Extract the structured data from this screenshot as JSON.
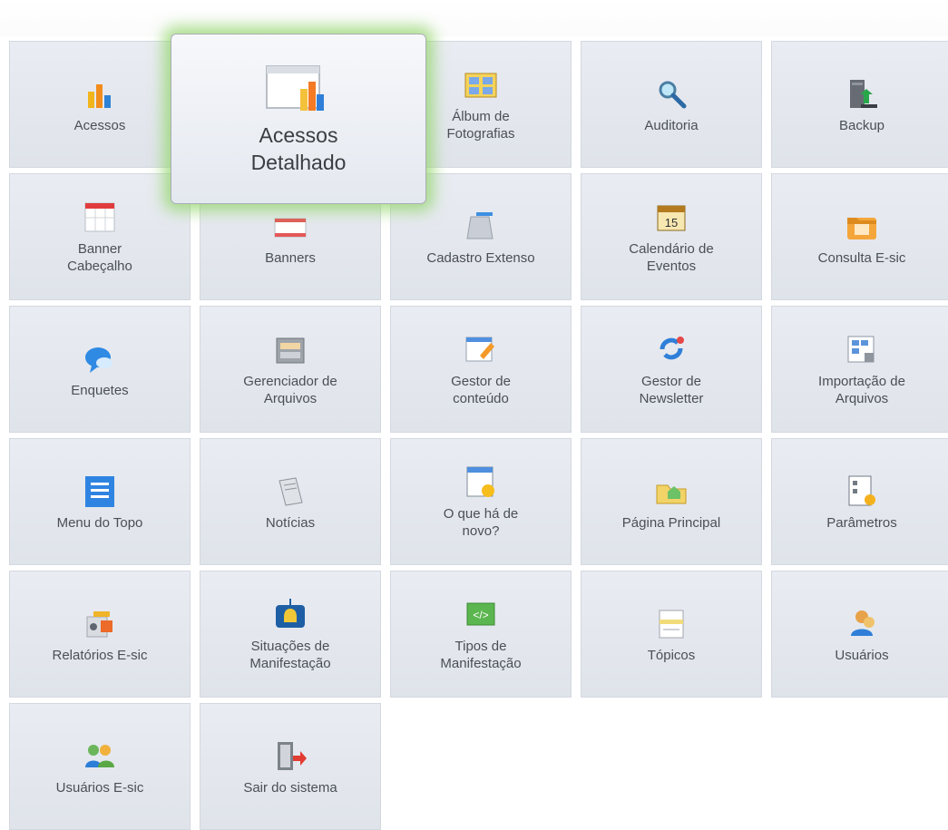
{
  "menu": {
    "hover_tile": {
      "label": "Acessos\nDetalhado",
      "icon": "report-chart-icon"
    },
    "tiles": [
      {
        "label": "Acessos",
        "icon": "chart-bars-icon"
      },
      {
        "label": "Acessos Detalhado",
        "icon": "report-chart-icon"
      },
      {
        "label": "Álbum de\nFotografias",
        "icon": "photo-album-icon"
      },
      {
        "label": "Auditoria",
        "icon": "magnifier-icon"
      },
      {
        "label": "Backup",
        "icon": "server-backup-icon"
      },
      {
        "label": "Banner\nCabeçalho",
        "icon": "calendar-grid-icon"
      },
      {
        "label": "Banners",
        "icon": "banner-icon"
      },
      {
        "label": "Cadastro Extenso",
        "icon": "form-icon"
      },
      {
        "label": "Calendário de\nEventos",
        "icon": "calendar-icon"
      },
      {
        "label": "Consulta E-sic",
        "icon": "folder-search-icon"
      },
      {
        "label": "Enquetes",
        "icon": "chat-bubble-icon"
      },
      {
        "label": "Gerenciador de\nArquivos",
        "icon": "file-cabinet-icon"
      },
      {
        "label": "Gestor de\nconteúdo",
        "icon": "edit-content-icon"
      },
      {
        "label": "Gestor de\nNewsletter",
        "icon": "refresh-mail-icon"
      },
      {
        "label": "Importação de\nArquivos",
        "icon": "import-icon"
      },
      {
        "label": "Menu do Topo",
        "icon": "list-icon"
      },
      {
        "label": "Notícias",
        "icon": "newspaper-icon"
      },
      {
        "label": "O que há de\nnovo?",
        "icon": "news-window-icon"
      },
      {
        "label": "Página Principal",
        "icon": "home-folder-icon"
      },
      {
        "label": "Parâmetros",
        "icon": "settings-document-icon"
      },
      {
        "label": "Relatórios E-sic",
        "icon": "reports-icon"
      },
      {
        "label": "Situações de\nManifestação",
        "icon": "bell-icon"
      },
      {
        "label": "Tipos de\nManifestação",
        "icon": "code-icon"
      },
      {
        "label": "Tópicos",
        "icon": "topic-icon"
      },
      {
        "label": "Usuários",
        "icon": "user-icon"
      },
      {
        "label": "Usuários E-sic",
        "icon": "users-group-icon"
      },
      {
        "label": "Sair do sistema",
        "icon": "exit-door-icon"
      }
    ]
  },
  "colors": {
    "tile_bg": "#e4e8ef",
    "hover_glow": "#92d669"
  }
}
